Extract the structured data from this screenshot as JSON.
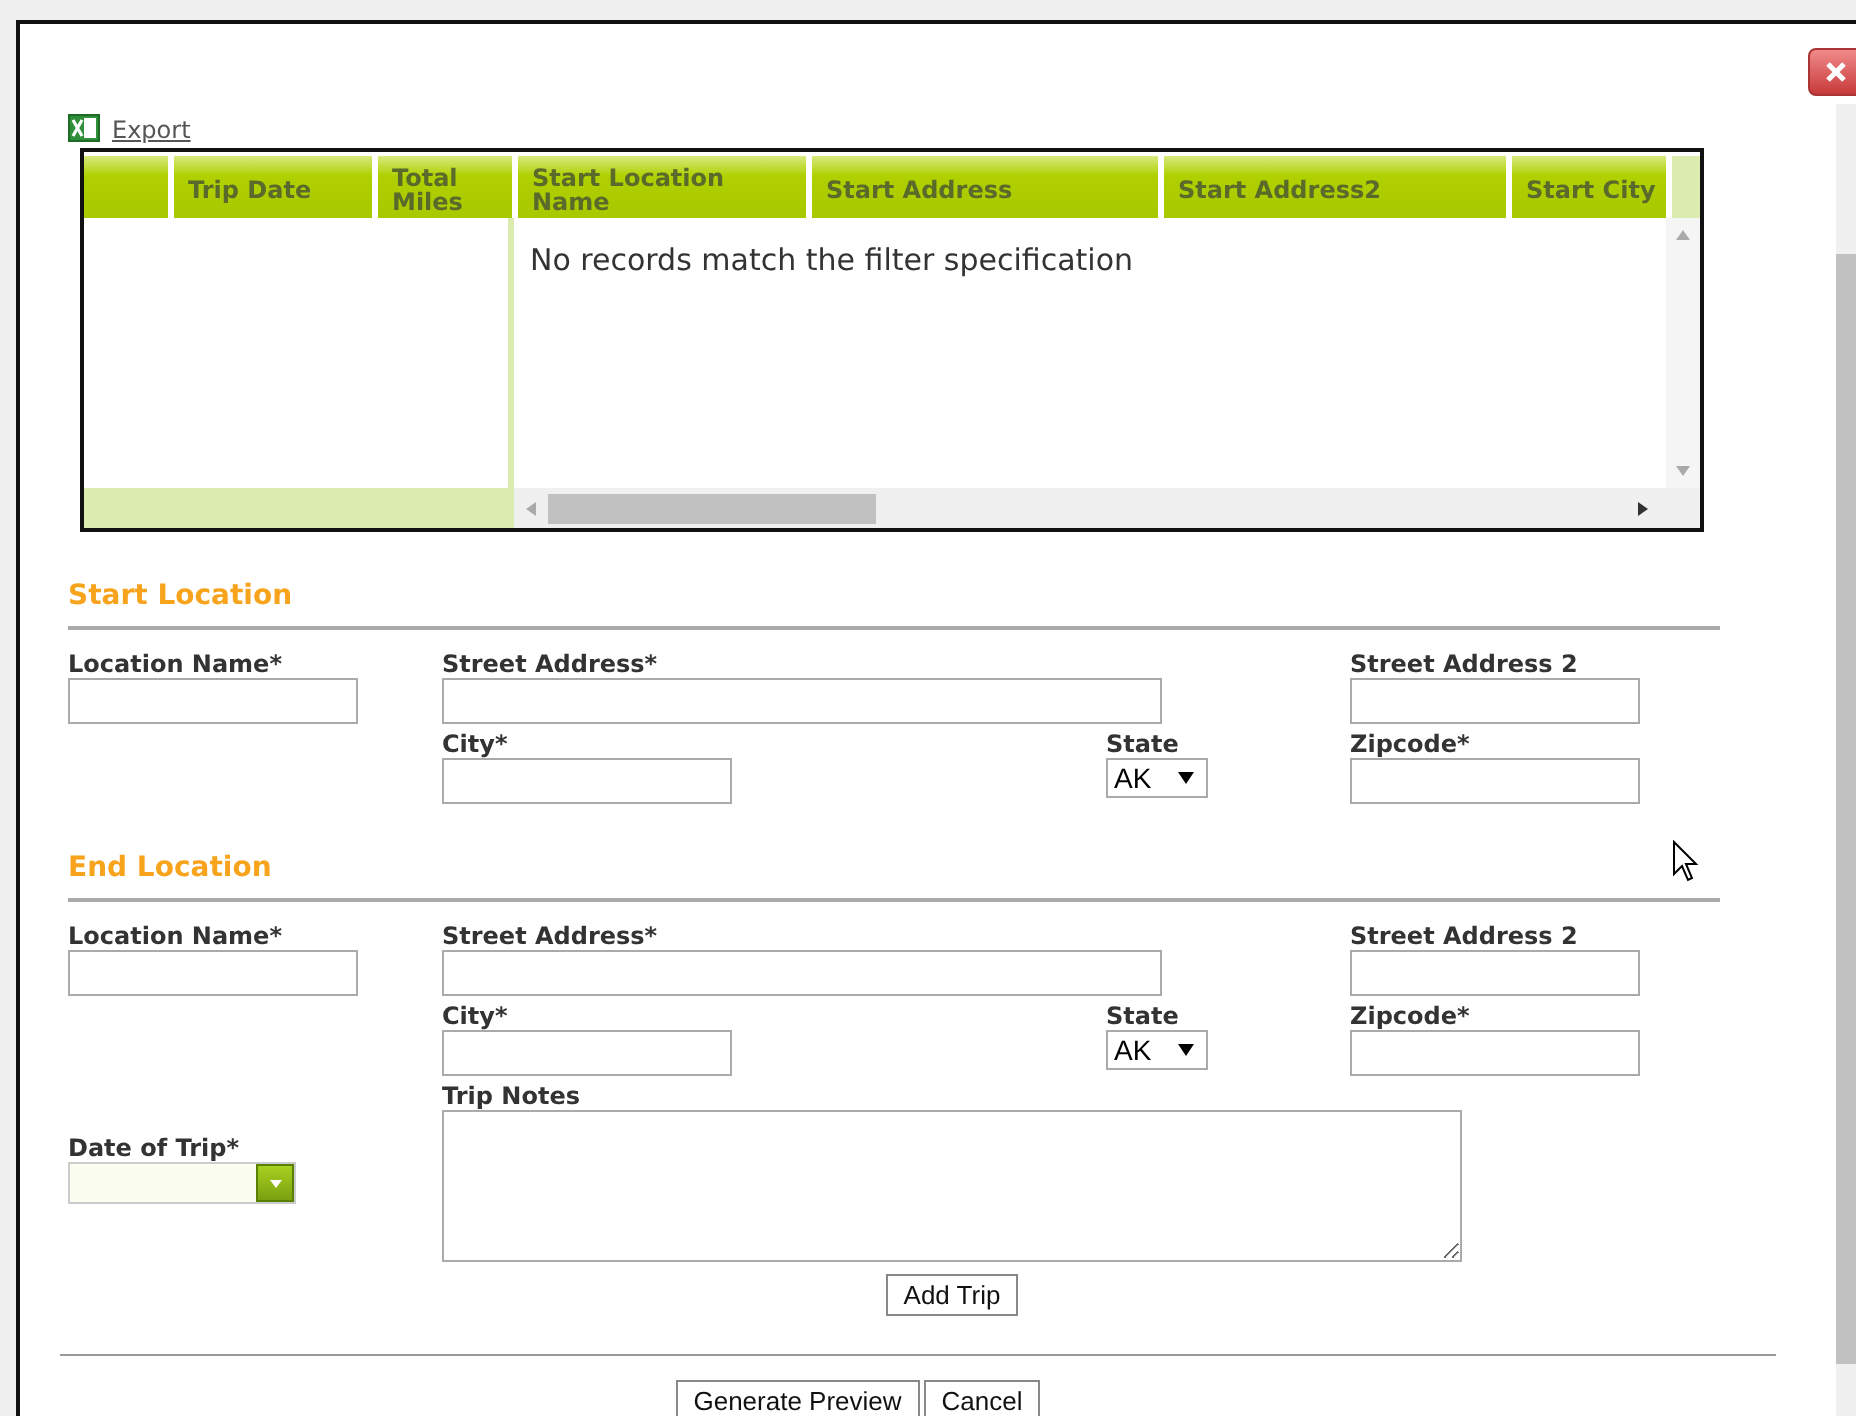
{
  "export_link": "Export",
  "grid": {
    "columns": [
      "Trip Date",
      "Total Miles",
      "Start Location Name",
      "Start Address",
      "Start Address2",
      "Start City"
    ],
    "empty_message": "No records match the filter specification"
  },
  "sections": [
    {
      "title": "Start Location",
      "fields": [
        {
          "label": "Location Name*",
          "kind": "text"
        },
        {
          "label": "Street Address*",
          "kind": "wide"
        },
        {
          "label": "Street Address 2",
          "kind": "text"
        },
        {
          "label": "City*",
          "kind": "text"
        },
        {
          "label": "State",
          "kind": "select",
          "value": "AK"
        },
        {
          "label": "Zipcode*",
          "kind": "text"
        }
      ]
    },
    {
      "title": "End Location",
      "fields": [
        {
          "label": "Location Name*",
          "kind": "text"
        },
        {
          "label": "Street Address*",
          "kind": "wide"
        },
        {
          "label": "Street Address 2",
          "kind": "text"
        },
        {
          "label": "City*",
          "kind": "text"
        },
        {
          "label": "State",
          "kind": "select",
          "value": "AK"
        },
        {
          "label": "Zipcode*",
          "kind": "text"
        }
      ]
    }
  ],
  "date_of_trip": {
    "label": "Date of Trip*"
  },
  "trip_notes": {
    "label": "Trip Notes"
  },
  "add_trip_button": "Add Trip",
  "footer_buttons": [
    "Generate Preview",
    "Cancel"
  ]
}
